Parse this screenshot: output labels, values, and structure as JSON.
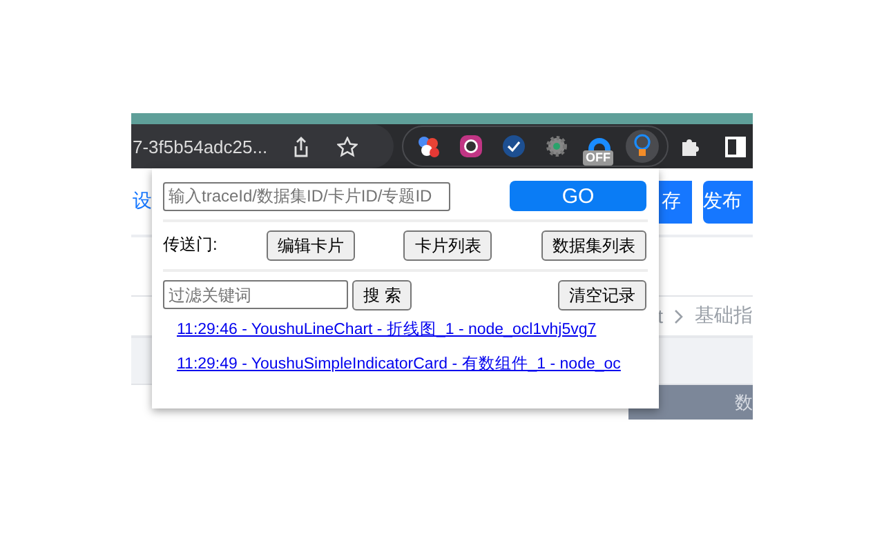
{
  "browser": {
    "address": "7-3f5b54adc25...",
    "extensions": [
      {
        "selected": false
      },
      {
        "selected": false
      },
      {
        "selected": false
      },
      {
        "selected": false
      },
      {
        "selected": false,
        "badge": "OFF"
      },
      {
        "selected": true
      }
    ]
  },
  "page": {
    "left_text": "设",
    "buttons": [
      "存",
      "发布"
    ],
    "breadcrumb": [
      "t",
      "基础指"
    ],
    "table_header": "数"
  },
  "popup": {
    "id_input": {
      "placeholder": "输入traceId/数据集ID/卡片ID/专题ID"
    },
    "go_button": "GO",
    "portal": {
      "label": "传送门:",
      "buttons": [
        "编辑卡片",
        "卡片列表",
        "数据集列表"
      ]
    },
    "filter": {
      "placeholder": "过滤关键词",
      "search_button": "搜 索",
      "clear_button": "清空记录"
    },
    "history": [
      "11:29:46 - YoushuLineChart - 折线图_1 - node_ocl1vhj5vg7",
      "11:29:49 - YoushuSimpleIndicatorCard - 有数组件_1 - node_oc"
    ]
  }
}
